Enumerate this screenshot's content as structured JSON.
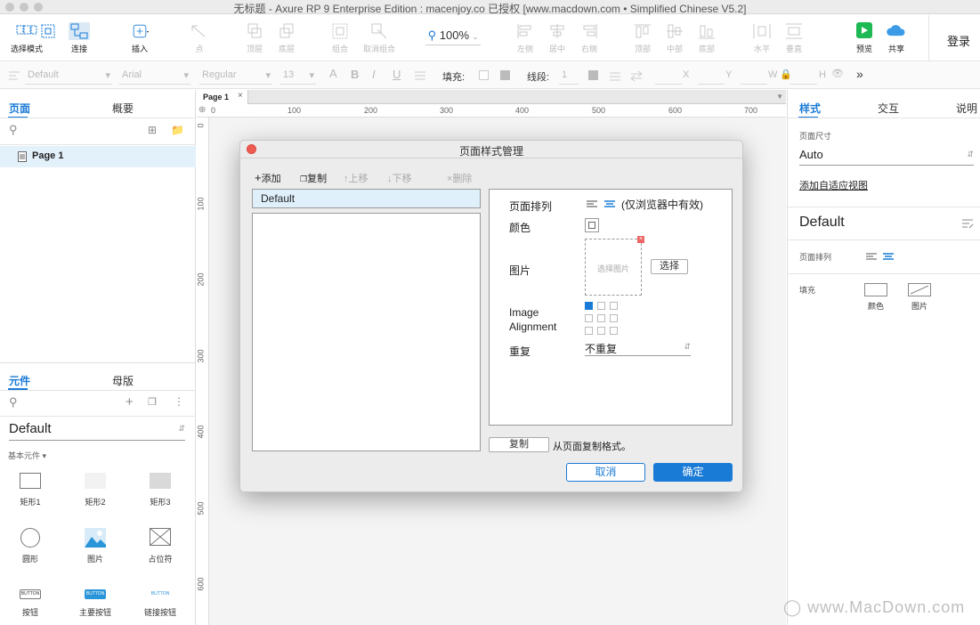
{
  "window": {
    "title": "无标题 - Axure RP 9 Enterprise Edition : macenjoy.co 已授权     [www.macdown.com • Simplified Chinese V5.2]"
  },
  "toolbar": {
    "select_mode": "选择模式",
    "connect": "连接",
    "insert": "插入",
    "point": "点",
    "top_layer": "顶层",
    "bottom_layer": "底层",
    "group": "组合",
    "ungroup": "取消组合",
    "zoom": "100%",
    "align_left": "左侧",
    "align_center": "居中",
    "align_right": "右侧",
    "align_top": "顶部",
    "align_middle": "中部",
    "align_bottom": "底部",
    "distribute_h": "水平",
    "distribute_v": "垂直",
    "preview": "预览",
    "share": "共享",
    "login": "登录"
  },
  "format_bar": {
    "style": "Default",
    "font": "Arial",
    "weight": "Regular",
    "size": "13",
    "fill_label": "填充:",
    "line_label": "线段:",
    "line_width": "1",
    "x": "X",
    "y": "Y",
    "w": "W",
    "h": "H"
  },
  "pages_panel": {
    "tab_pages": "页面",
    "tab_outline": "概要",
    "page_item": "Page 1"
  },
  "widgets_panel": {
    "tab_widgets": "元件",
    "tab_masters": "母版",
    "library": "Default",
    "section": "基本元件 ▾",
    "items": [
      {
        "label": "矩形1"
      },
      {
        "label": "矩形2"
      },
      {
        "label": "矩形3"
      },
      {
        "label": "圆形"
      },
      {
        "label": "图片"
      },
      {
        "label": "占位符"
      },
      {
        "label": "按钮"
      },
      {
        "label": "主要按钮"
      },
      {
        "label": "链接按钮"
      }
    ],
    "button_text": "BUTTON"
  },
  "canvas": {
    "page_tab": "Page 1",
    "ruler_top": [
      "0",
      "100",
      "200",
      "300",
      "400",
      "500",
      "600",
      "700"
    ],
    "ruler_left": [
      "0",
      "100",
      "200",
      "300",
      "400",
      "500",
      "600"
    ]
  },
  "right_panel": {
    "tab_style": "样式",
    "tab_interaction": "交互",
    "tab_notes": "说明",
    "page_size_label": "页面尺寸",
    "page_size_value": "Auto",
    "adaptive_link": "添加自适应视图",
    "style_name": "Default",
    "page_align_label": "页面排列",
    "fill_label": "填充",
    "fill_color": "颜色",
    "fill_image": "图片"
  },
  "dialog": {
    "title": "页面样式管理",
    "add": "添加",
    "copy": "复制",
    "move_up": "上移",
    "move_down": "下移",
    "delete": "删除",
    "style_item": "Default",
    "page_align": "页面排列",
    "align_note": "(仅浏览器中有效)",
    "color": "颜色",
    "image": "图片",
    "image_placeholder": "选择图片",
    "choose": "选择",
    "image_alignment": "Image Alignment",
    "repeat": "重复",
    "repeat_value": "不重复",
    "copy_button": "复制",
    "copy_note": "从页面复制格式。",
    "cancel": "取消",
    "ok": "确定"
  },
  "watermark": "www.MacDown.com",
  "colors": {
    "accent": "#1a7bd6",
    "preview_green": "#1db954",
    "share_blue": "#3b9be6",
    "close_red": "#ee5b50"
  }
}
